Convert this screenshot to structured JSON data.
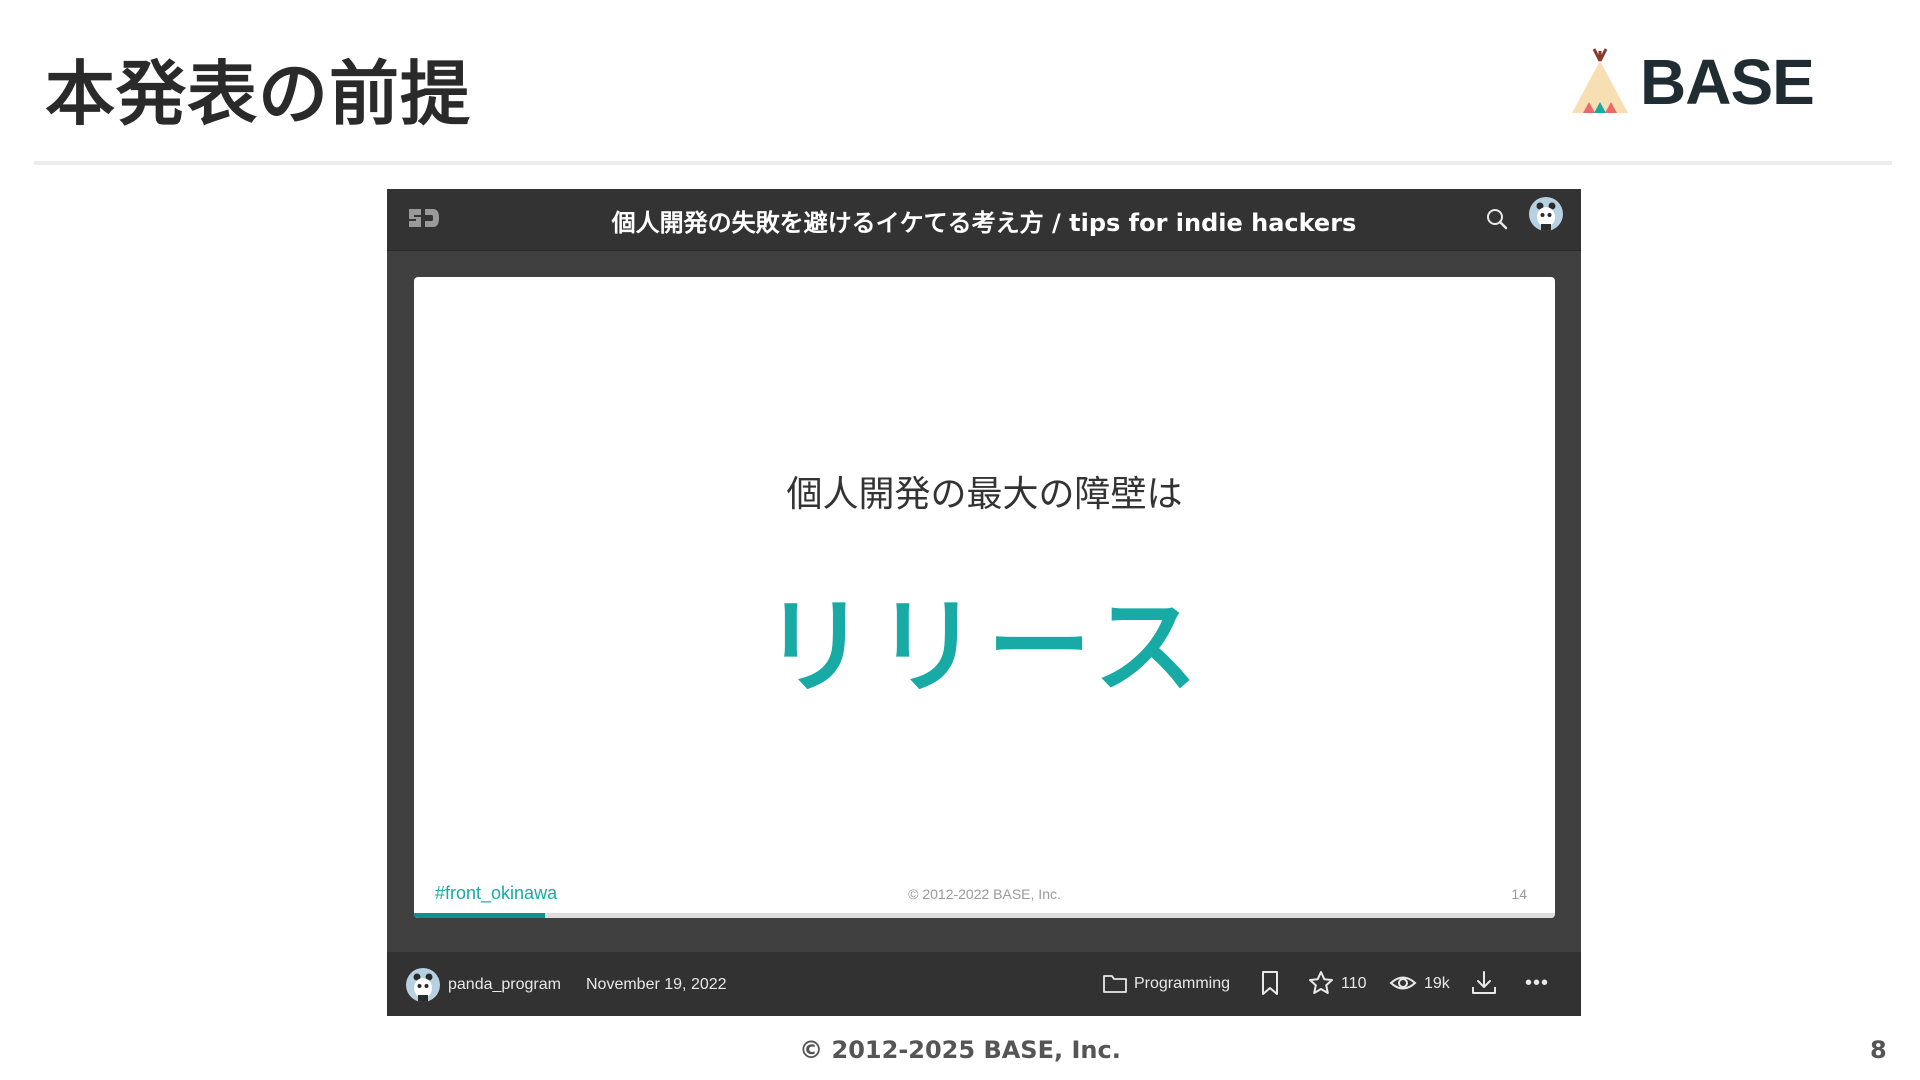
{
  "slide": {
    "title": "本発表の前提",
    "brand": "BASE",
    "footer_copyright": "© 2012-2025 BASE, Inc.",
    "page_number": "8"
  },
  "embed": {
    "deck_title": "個人開発の失敗を避けるイケてる考え方 / tips for indie hackers",
    "current_slide": {
      "lead": "個人開発の最大の障壁は",
      "headline": "リリース",
      "hashtag": "#front_okinawa",
      "copyright": "© 2012-2022 BASE, Inc.",
      "page": "14"
    },
    "progress_fraction": 0.115,
    "footer": {
      "username": "panda_program",
      "date": "November 19, 2022",
      "category": "Programming",
      "stars": "110",
      "views": "19k"
    }
  },
  "colors": {
    "accent": "#18aaa4",
    "embed_bg": "#343434",
    "brand_text": "#1f2d33"
  },
  "icons": [
    "speakerdeck-logo-icon",
    "search-icon",
    "avatar",
    "folder-icon",
    "bookmark-icon",
    "star-icon",
    "eye-icon",
    "download-icon",
    "more-icon",
    "teepee-logo-icon"
  ]
}
